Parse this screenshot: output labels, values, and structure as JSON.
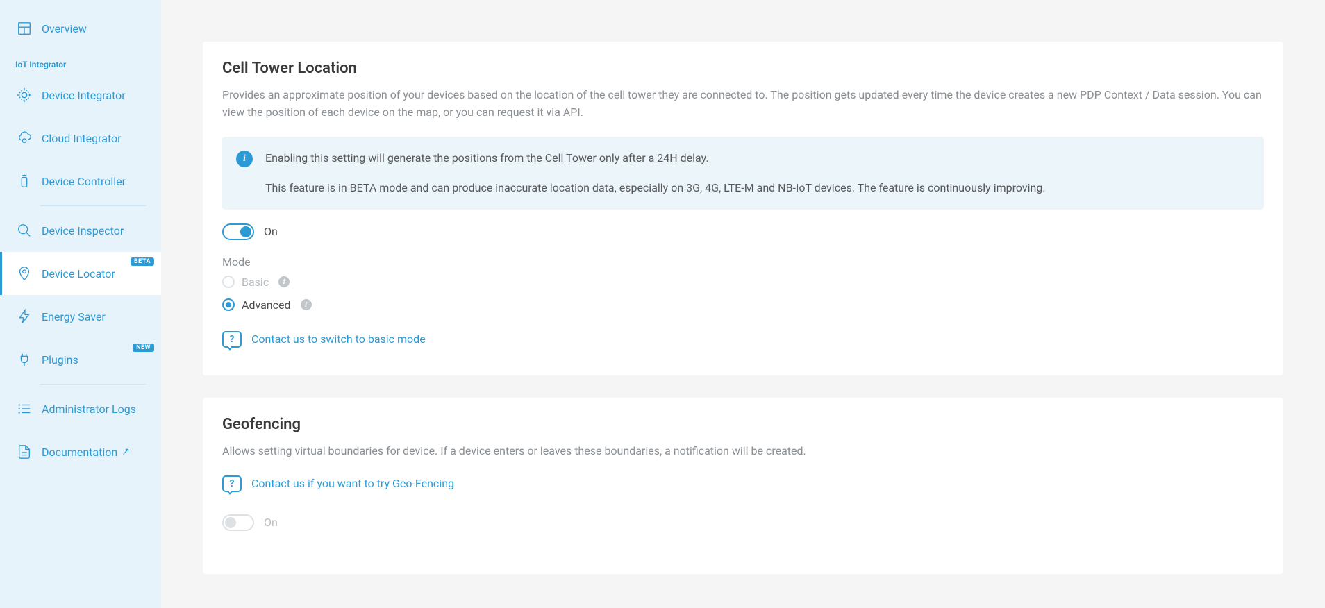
{
  "sidebar": {
    "overview": "Overview",
    "section_label": "IoT Integrator",
    "items": [
      {
        "label": "Device Integrator"
      },
      {
        "label": "Cloud Integrator"
      },
      {
        "label": "Device Controller"
      },
      {
        "label": "Device Inspector"
      },
      {
        "label": "Device Locator",
        "badge": "BETA",
        "active": true
      },
      {
        "label": "Energy Saver"
      },
      {
        "label": "Plugins",
        "badge": "NEW"
      },
      {
        "label": "Administrator Logs"
      },
      {
        "label": "Documentation",
        "external": true
      }
    ]
  },
  "cell_tower": {
    "title": "Cell Tower Location",
    "description": "Provides an approximate position of your devices based on the location of the cell tower they are connected to. The position gets updated every time the device creates a new PDP Context / Data session. You can view the position of each device on the map, or you can request it via API.",
    "info_line1": "Enabling this setting will generate the positions from the Cell Tower only after a 24H delay.",
    "info_line2": "This feature is in BETA mode and can produce inaccurate location data, especially on 3G, 4G, LTE-M and NB-IoT devices. The feature is continuously improving.",
    "toggle_label": "On",
    "toggle_state": "on",
    "mode_label": "Mode",
    "mode_options": {
      "basic": "Basic",
      "advanced": "Advanced"
    },
    "selected_mode": "advanced",
    "contact_link": "Contact us to switch to basic mode"
  },
  "geofencing": {
    "title": "Geofencing",
    "description": "Allows setting virtual boundaries for device. If a device enters or leaves these boundaries, a notification will be created.",
    "contact_link": "Contact us if you want to try Geo-Fencing",
    "toggle_label": "On",
    "toggle_state": "off"
  }
}
